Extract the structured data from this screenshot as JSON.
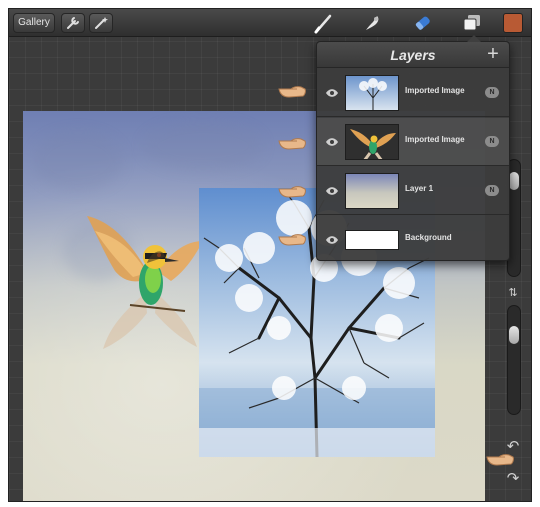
{
  "toolbar": {
    "gallery_label": "Gallery",
    "icons": [
      "wrench-icon",
      "magic-wand-icon",
      "brush-icon",
      "smudge-icon",
      "eraser-icon",
      "layers-icon"
    ],
    "current_color": "#b85a34"
  },
  "layers_panel": {
    "title": "Layers",
    "add_label": "+",
    "layers": [
      {
        "name": "Imported Image",
        "blend": "N",
        "thumb": "winter-tree"
      },
      {
        "name": "Imported Image",
        "blend": "N",
        "thumb": "bird"
      },
      {
        "name": "Layer 1",
        "blend": "N",
        "thumb": "texture"
      },
      {
        "name": "Background",
        "blend": "",
        "thumb": "white"
      }
    ]
  },
  "sidebar": {
    "icons": [
      "swap-icon",
      "undo-icon",
      "redo-icon"
    ]
  },
  "colors": {
    "accent": "#3a7bd5",
    "panel": "#3c3c3c",
    "canvas_bg": "#3b3b3b"
  }
}
